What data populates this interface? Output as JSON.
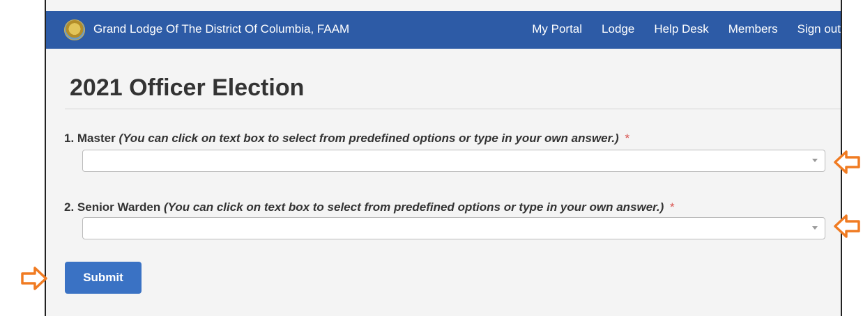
{
  "header": {
    "brand": "Grand Lodge Of The District Of Columbia, FAAM",
    "nav": [
      "My Portal",
      "Lodge",
      "Help Desk",
      "Members",
      "Sign out"
    ]
  },
  "page": {
    "title": "2021 Officer Election"
  },
  "questions": [
    {
      "label": "1. Master",
      "hint": "(You can click on text box to select from predefined options or type in your own answer.)",
      "required": "*",
      "value": ""
    },
    {
      "label": "2. Senior Warden",
      "hint": "(You can click on text box to select from predefined options or type in your own answer.)",
      "required": "*",
      "value": ""
    }
  ],
  "submit_label": "Submit",
  "colors": {
    "topbar": "#2d5ba6",
    "button": "#3a72c4",
    "arrow": "#f07b22",
    "required": "#d9534f"
  },
  "icons": [
    "seal-logo-icon",
    "dropdown-caret-icon",
    "pointer-arrow-icon"
  ]
}
